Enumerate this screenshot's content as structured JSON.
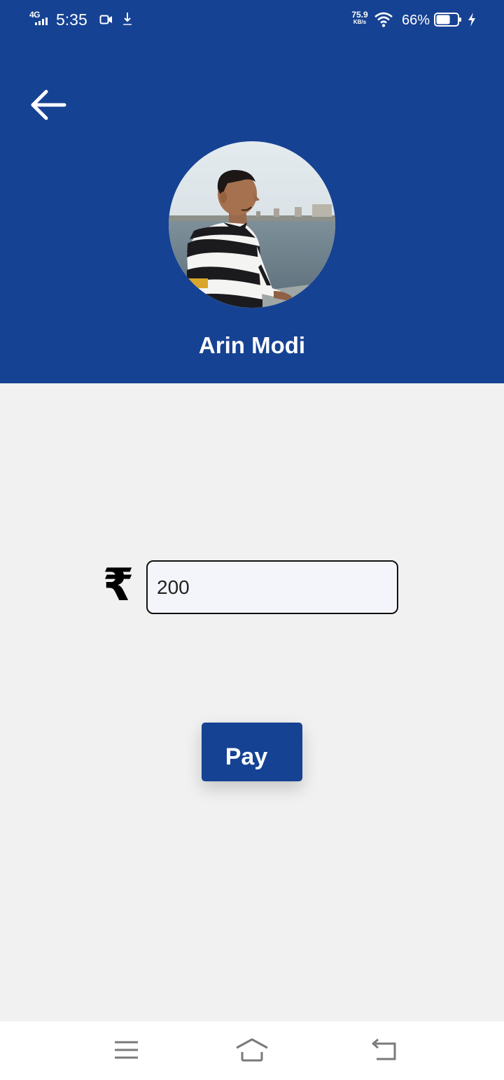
{
  "status_bar": {
    "network": "4G",
    "time": "5:35",
    "speed_value": "75.9",
    "speed_unit": "KB/s",
    "battery_percent": "66%",
    "battery_level": 0.66,
    "icons": [
      "signal-icon",
      "video-camera-icon",
      "download-icon",
      "wifi-icon",
      "battery-icon",
      "charging-icon"
    ]
  },
  "header": {
    "back_icon": "arrow-left-icon",
    "contact_name": "Arin Modi",
    "avatar": "profile-photo"
  },
  "payment": {
    "currency_symbol": "₹",
    "currency_icon": "rupee-icon",
    "amount_value": "200",
    "pay_label": "Pay"
  },
  "nav_bar": {
    "icons": [
      "menu-icon",
      "home-icon",
      "back-icon"
    ]
  },
  "colors": {
    "primary": "#164293",
    "background": "#f1f1f1",
    "input_background": "#f4f5fa",
    "text_on_primary": "#ffffff"
  }
}
